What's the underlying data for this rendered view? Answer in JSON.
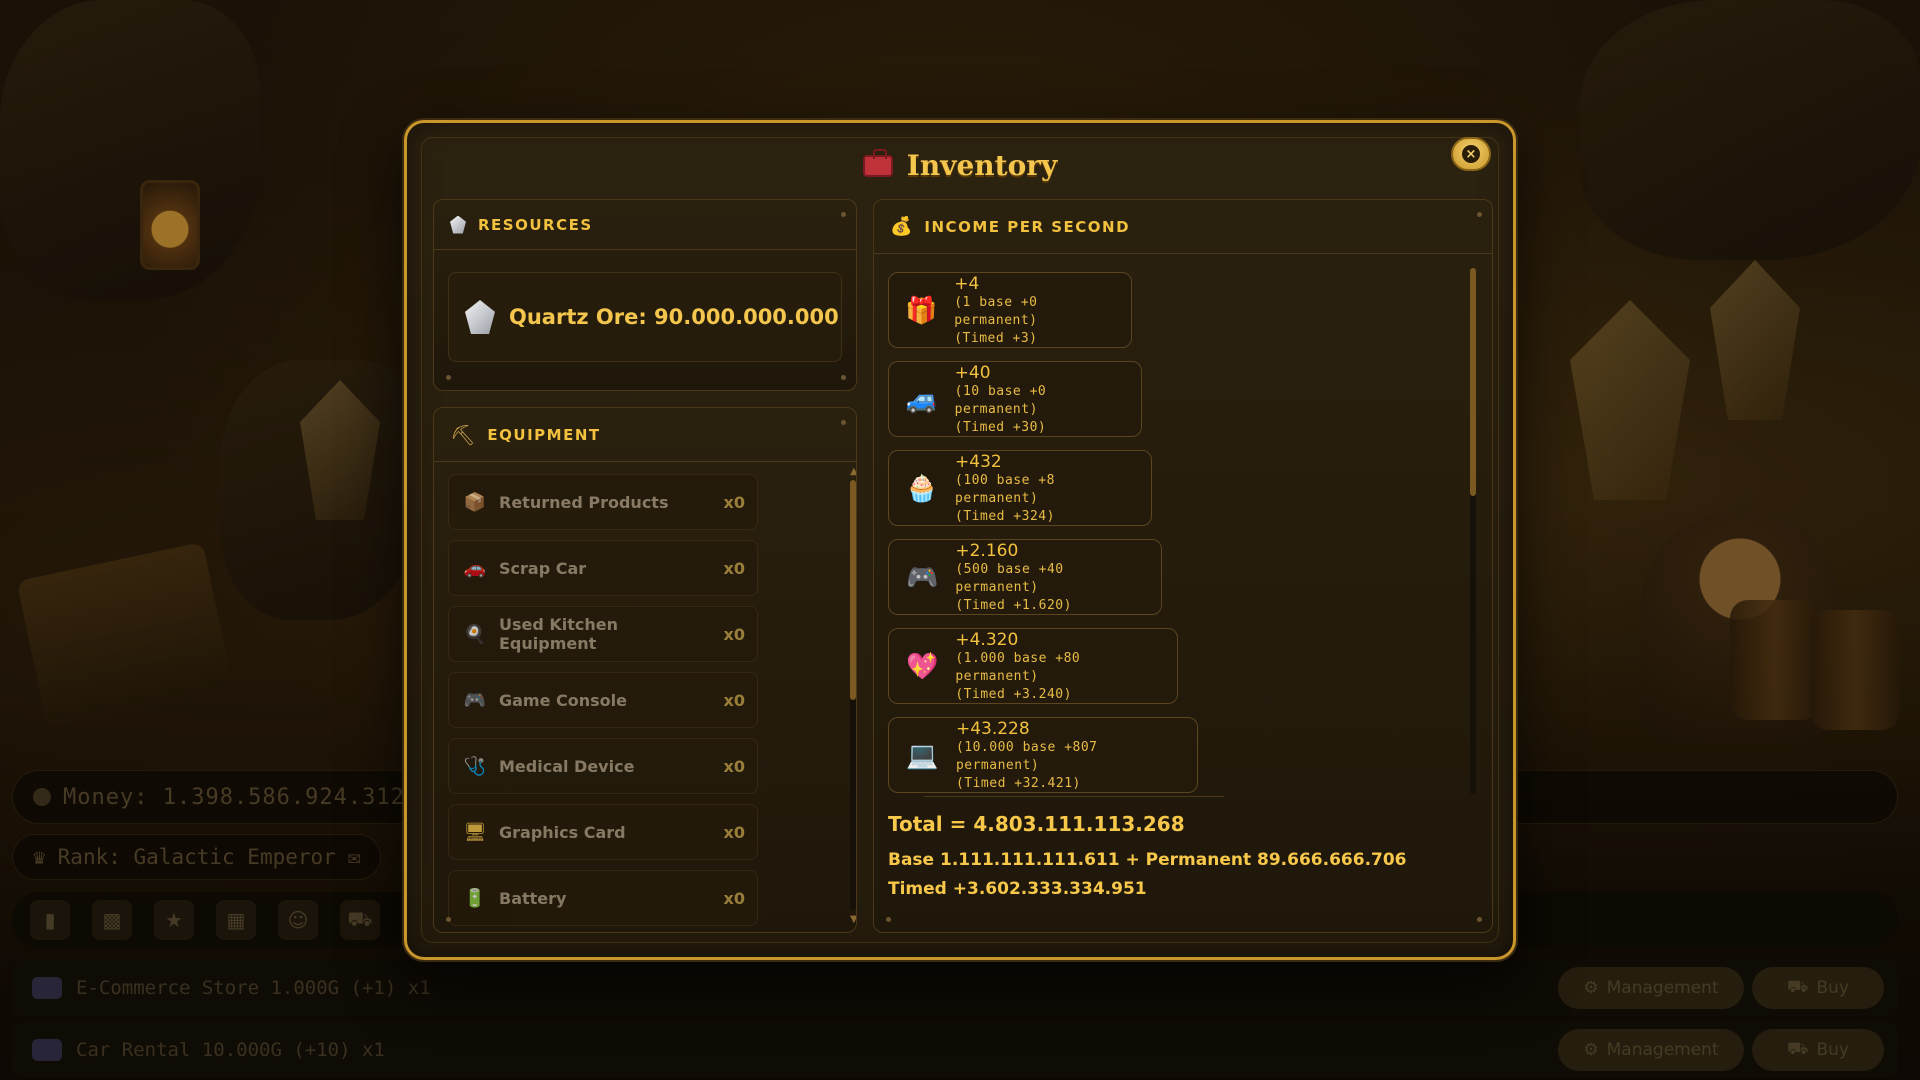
{
  "modal": {
    "title": "Inventory",
    "title_icon": "toolbox-icon",
    "close_label": "×"
  },
  "resources": {
    "heading": "RESOURCES",
    "quartz_label": "Quartz Ore: 90.000.000.000"
  },
  "equipment": {
    "heading": "EQUIPMENT",
    "items": [
      {
        "name": "Returned Products",
        "qty": "x0",
        "icon": "box-icon",
        "glyph": "📦"
      },
      {
        "name": "Scrap Car",
        "qty": "x0",
        "icon": "car-icon",
        "glyph": "🚗"
      },
      {
        "name": "Used Kitchen Equipment",
        "qty": "x0",
        "icon": "pan-icon",
        "glyph": "🍳"
      },
      {
        "name": "Game Console",
        "qty": "x0",
        "icon": "gamepad-icon",
        "glyph": "🎮"
      },
      {
        "name": "Medical Device",
        "qty": "x0",
        "icon": "stethoscope-icon",
        "glyph": "🩺"
      },
      {
        "name": "Graphics Card",
        "qty": "x0",
        "icon": "monitor-icon",
        "glyph": "🖥"
      },
      {
        "name": "Battery",
        "qty": "x0",
        "icon": "battery-icon",
        "glyph": "🔋"
      }
    ]
  },
  "income": {
    "heading": "INCOME PER SECOND",
    "rows": [
      {
        "amount": "+4",
        "base": "(1 base +0 permanent)",
        "timed": "(Timed +3)",
        "icon": "gift-box-icon",
        "glyph": "🎁"
      },
      {
        "amount": "+40",
        "base": "(10 base +0 permanent)",
        "timed": "(Timed +30)",
        "icon": "car-icon",
        "glyph": "🚙"
      },
      {
        "amount": "+432",
        "base": "(100 base +8 permanent)",
        "timed": "(Timed +324)",
        "icon": "cupcake-icon",
        "glyph": "🧁"
      },
      {
        "amount": "+2.160",
        "base": "(500 base +40 permanent)",
        "timed": "(Timed +1.620)",
        "icon": "gamepad-icon",
        "glyph": "🎮"
      },
      {
        "amount": "+4.320",
        "base": "(1.000 base +80 permanent)",
        "timed": "(Timed +3.240)",
        "icon": "heart-health-icon",
        "glyph": "💖"
      },
      {
        "amount": "+43.228",
        "base": "(10.000 base +807 permanent)",
        "timed": "(Timed +32.421)",
        "icon": "laptop-icon",
        "glyph": "💻"
      }
    ],
    "total": "Total = 4.803.111.113.268",
    "base_perm": "Base 1.111.111.111.611 + Permanent 89.666.666.706",
    "timed": "Timed +3.602.333.334.951"
  },
  "hud": {
    "money": "Money: 1.398.586.924.312.5",
    "rank": "Rank: Galactic Emperor",
    "businesses": [
      {
        "label": "E-Commerce Store 1.000G (+1) x1",
        "manage": "Management",
        "buy": "Buy"
      },
      {
        "label": "Car Rental 10.000G (+10) x1",
        "manage": "Management",
        "buy": "Buy"
      }
    ]
  },
  "colors": {
    "accent": "#f2c13e",
    "frame": "#c9962c",
    "panel": "#2a200e"
  }
}
